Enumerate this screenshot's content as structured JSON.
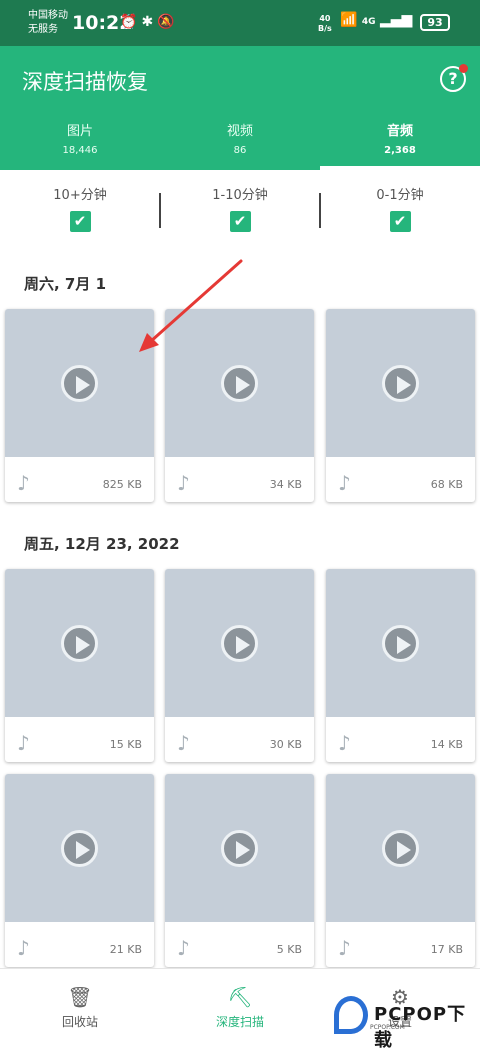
{
  "status_bar": {
    "carrier_line1": "中国移动",
    "carrier_line2": "无服务",
    "time": "10:22",
    "net_speed_value": "40",
    "net_speed_unit": "B/s",
    "network": "4G",
    "battery": "93"
  },
  "app_bar": {
    "title": "深度扫描恢复",
    "help_label": "?"
  },
  "tabs": [
    {
      "label": "图片",
      "count": "18,446"
    },
    {
      "label": "视频",
      "count": "86"
    },
    {
      "label": "音频",
      "count": "2,368"
    }
  ],
  "filters": [
    {
      "label": "10+分钟",
      "checked": true
    },
    {
      "label": "1-10分钟",
      "checked": true
    },
    {
      "label": "0-1分钟",
      "checked": true
    }
  ],
  "groups": [
    {
      "date": "周六, 7月 1",
      "items": [
        "825 KB",
        "34 KB",
        "68 KB"
      ]
    },
    {
      "date": "周五, 12月 23, 2022",
      "items": [
        "15 KB",
        "30 KB",
        "14 KB",
        "21 KB",
        "5 KB",
        "17 KB"
      ]
    }
  ],
  "bottom_nav": [
    {
      "label": "回收站",
      "icon": "trash-icon"
    },
    {
      "label": "深度扫描",
      "icon": "drill-icon"
    },
    {
      "label": "设置",
      "icon": "gear-icon"
    }
  ],
  "watermark": {
    "text": "PCPOP下载",
    "sub": "PCPOP.COM"
  },
  "colors": {
    "accent": "#25b57c",
    "status_bar": "#1e7a50",
    "annotation_arrow": "#e53935"
  }
}
